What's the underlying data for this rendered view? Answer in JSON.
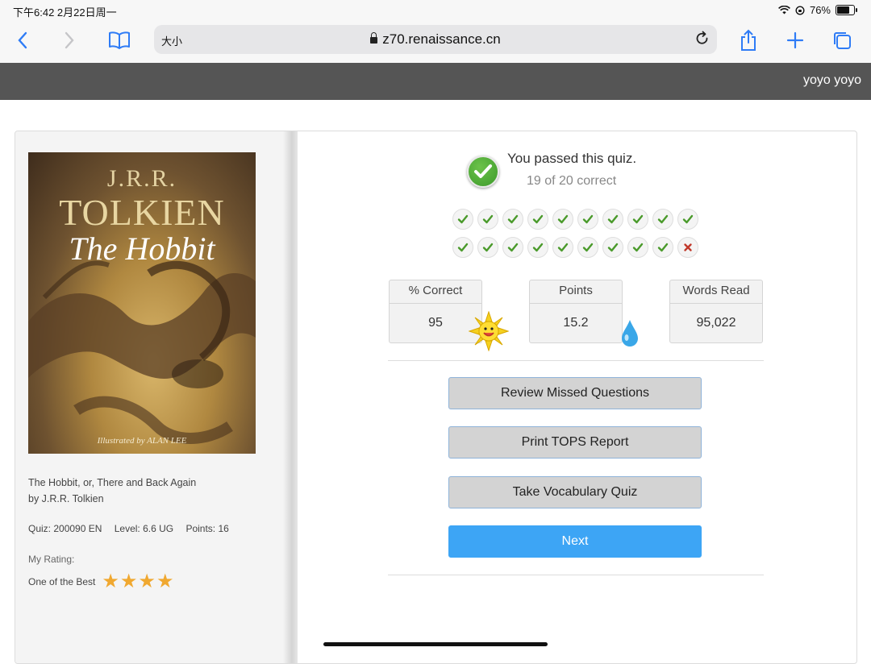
{
  "status_bar": {
    "time_date": "下午6:42   2月22日周一",
    "battery": "76%",
    "battery_level": 0.76
  },
  "browser": {
    "text_size_label": "大小",
    "url": "z70.renaissance.cn"
  },
  "header": {
    "username": "yoyo yoyo"
  },
  "book": {
    "cover": {
      "author": "J.R.R.",
      "author_surname": "TOLKIEN",
      "title": "The Hobbit",
      "illustrated_by": "Illustrated by ALAN LEE"
    },
    "full_title": "The Hobbit, or, There and Back Again",
    "byline": "by J.R.R. Tolkien",
    "quiz": "Quiz: 200090 EN",
    "level": "Level: 6.6 UG",
    "points": "Points: 16",
    "rating_label": "My Rating:",
    "rating_text": "One of the Best",
    "rating_stars": 4,
    "stars_text": "★★★★"
  },
  "result": {
    "title": "You passed this quiz.",
    "score_text": "19 of 20 correct",
    "answers": [
      true,
      true,
      true,
      true,
      true,
      true,
      true,
      true,
      true,
      true,
      true,
      true,
      true,
      true,
      true,
      true,
      true,
      true,
      true,
      false
    ]
  },
  "stats": [
    {
      "label": "% Correct",
      "value": "95"
    },
    {
      "label": "Points",
      "value": "15.2"
    },
    {
      "label": "Words Read",
      "value": "95,022"
    }
  ],
  "buttons": {
    "review": "Review Missed Questions",
    "print": "Print TOPS Report",
    "vocab": "Take Vocabulary Quiz",
    "next": "Next"
  },
  "colors": {
    "accent": "#3da5f5",
    "header_bg": "#555555",
    "correct": "#4a9a2b",
    "wrong": "#c0392b",
    "star": "#f0a830"
  }
}
